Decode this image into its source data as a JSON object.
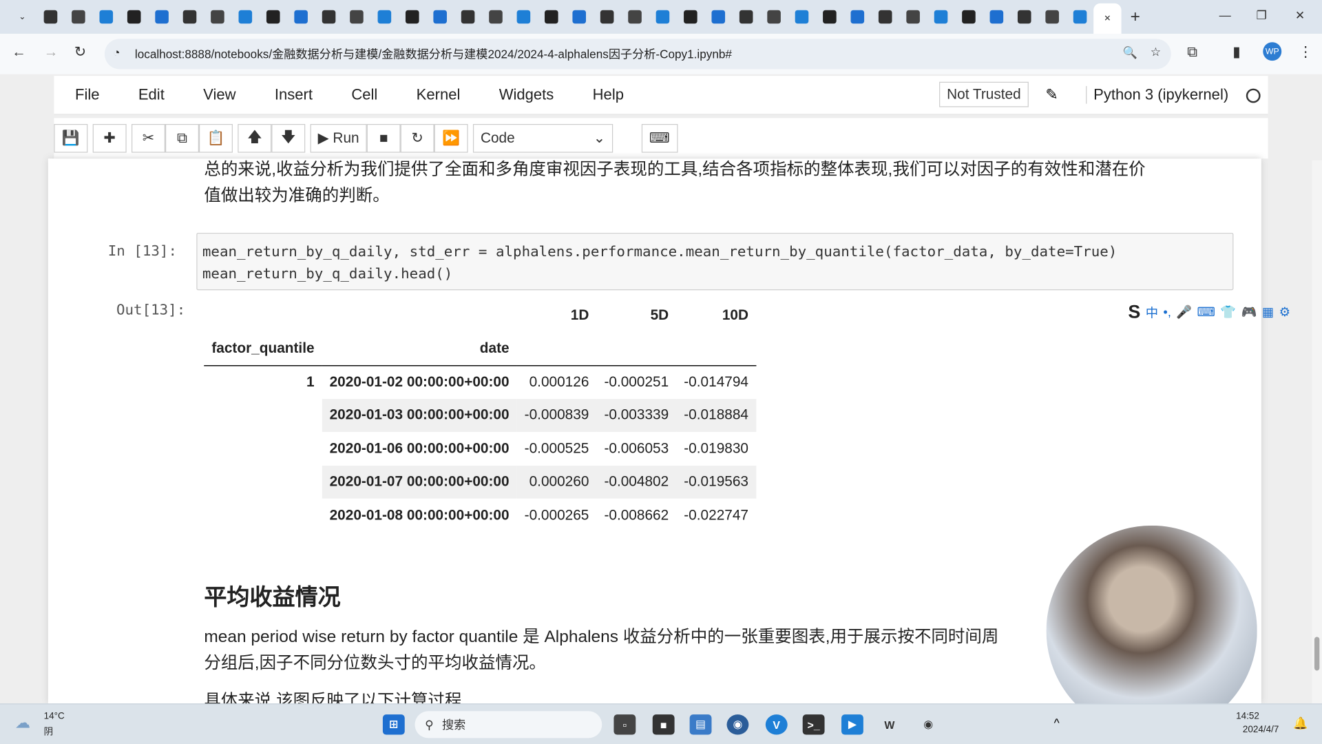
{
  "browser": {
    "tab_icons": [
      "chevron-down",
      "copilot",
      "bot",
      "openai",
      "zhihu",
      "github",
      "c",
      "github",
      "o",
      "a",
      "bilibili",
      "csdn",
      "note",
      "note",
      "cloud",
      "cloud",
      "k",
      "book",
      "flower",
      "google",
      "chrome",
      "doc",
      "translate",
      "book",
      "github",
      "github",
      "c",
      "c",
      "edge",
      "zhihu",
      "zhihu",
      "zhihu",
      "github",
      "github",
      "edge",
      "github",
      "loading",
      "note",
      "note",
      "jupyter-active"
    ],
    "new_tab": "+",
    "url": "localhost:8888/notebooks/金融数据分析与建模/金融数据分析与建模2024/2024-4-alphalens因子分析-Copy1.ipynb#"
  },
  "jupyter": {
    "menu": [
      "File",
      "Edit",
      "View",
      "Insert",
      "Cell",
      "Kernel",
      "Widgets",
      "Help"
    ],
    "not_trusted": "Not Trusted",
    "kernel": "Python 3 (ipykernel)",
    "run_label": "Run",
    "cell_type": "Code"
  },
  "notebook": {
    "md_top": [
      "总的来说,收益分析为我们提供了全面和多角度审视因子表现的工具,结合各项指标的整体表现,我们可以对因子的有效性和潜在价",
      "值做出较为准确的判断。"
    ],
    "in_prompt": "In  [13]:",
    "code": [
      "mean_return_by_q_daily, std_err = alphalens.performance.mean_return_by_quantile(factor_data, by_date=True)",
      "mean_return_by_q_daily.head()"
    ],
    "out_prompt": "Out[13]:",
    "table": {
      "columns": [
        "1D",
        "5D",
        "10D"
      ],
      "index_names": [
        "factor_quantile",
        "date"
      ],
      "rows": [
        {
          "q": "1",
          "date": "2020-01-02 00:00:00+00:00",
          "v": [
            "0.000126",
            "-0.000251",
            "-0.014794"
          ]
        },
        {
          "q": "",
          "date": "2020-01-03 00:00:00+00:00",
          "v": [
            "-0.000839",
            "-0.003339",
            "-0.018884"
          ]
        },
        {
          "q": "",
          "date": "2020-01-06 00:00:00+00:00",
          "v": [
            "-0.000525",
            "-0.006053",
            "-0.019830"
          ]
        },
        {
          "q": "",
          "date": "2020-01-07 00:00:00+00:00",
          "v": [
            "0.000260",
            "-0.004802",
            "-0.019563"
          ]
        },
        {
          "q": "",
          "date": "2020-01-08 00:00:00+00:00",
          "v": [
            "-0.000265",
            "-0.008662",
            "-0.022747"
          ]
        }
      ]
    },
    "heading": "平均收益情况",
    "md_bottom": [
      "mean period wise return by factor quantile 是 Alphalens 收益分析中的一张重要图表,用于展示按不同时间周",
      "分组后,因子不同分位数头寸的平均收益情况。",
      "具体来说,该图反映了以下计算过程"
    ]
  },
  "ime": [
    "S",
    "中",
    "•,",
    "🎤",
    "⌨",
    "👕",
    "🎮",
    "▦",
    "⚙"
  ],
  "taskbar": {
    "temp": "14°C",
    "weather": "阴",
    "search": "搜索",
    "time": "14:52",
    "date": "2024/4/7"
  }
}
